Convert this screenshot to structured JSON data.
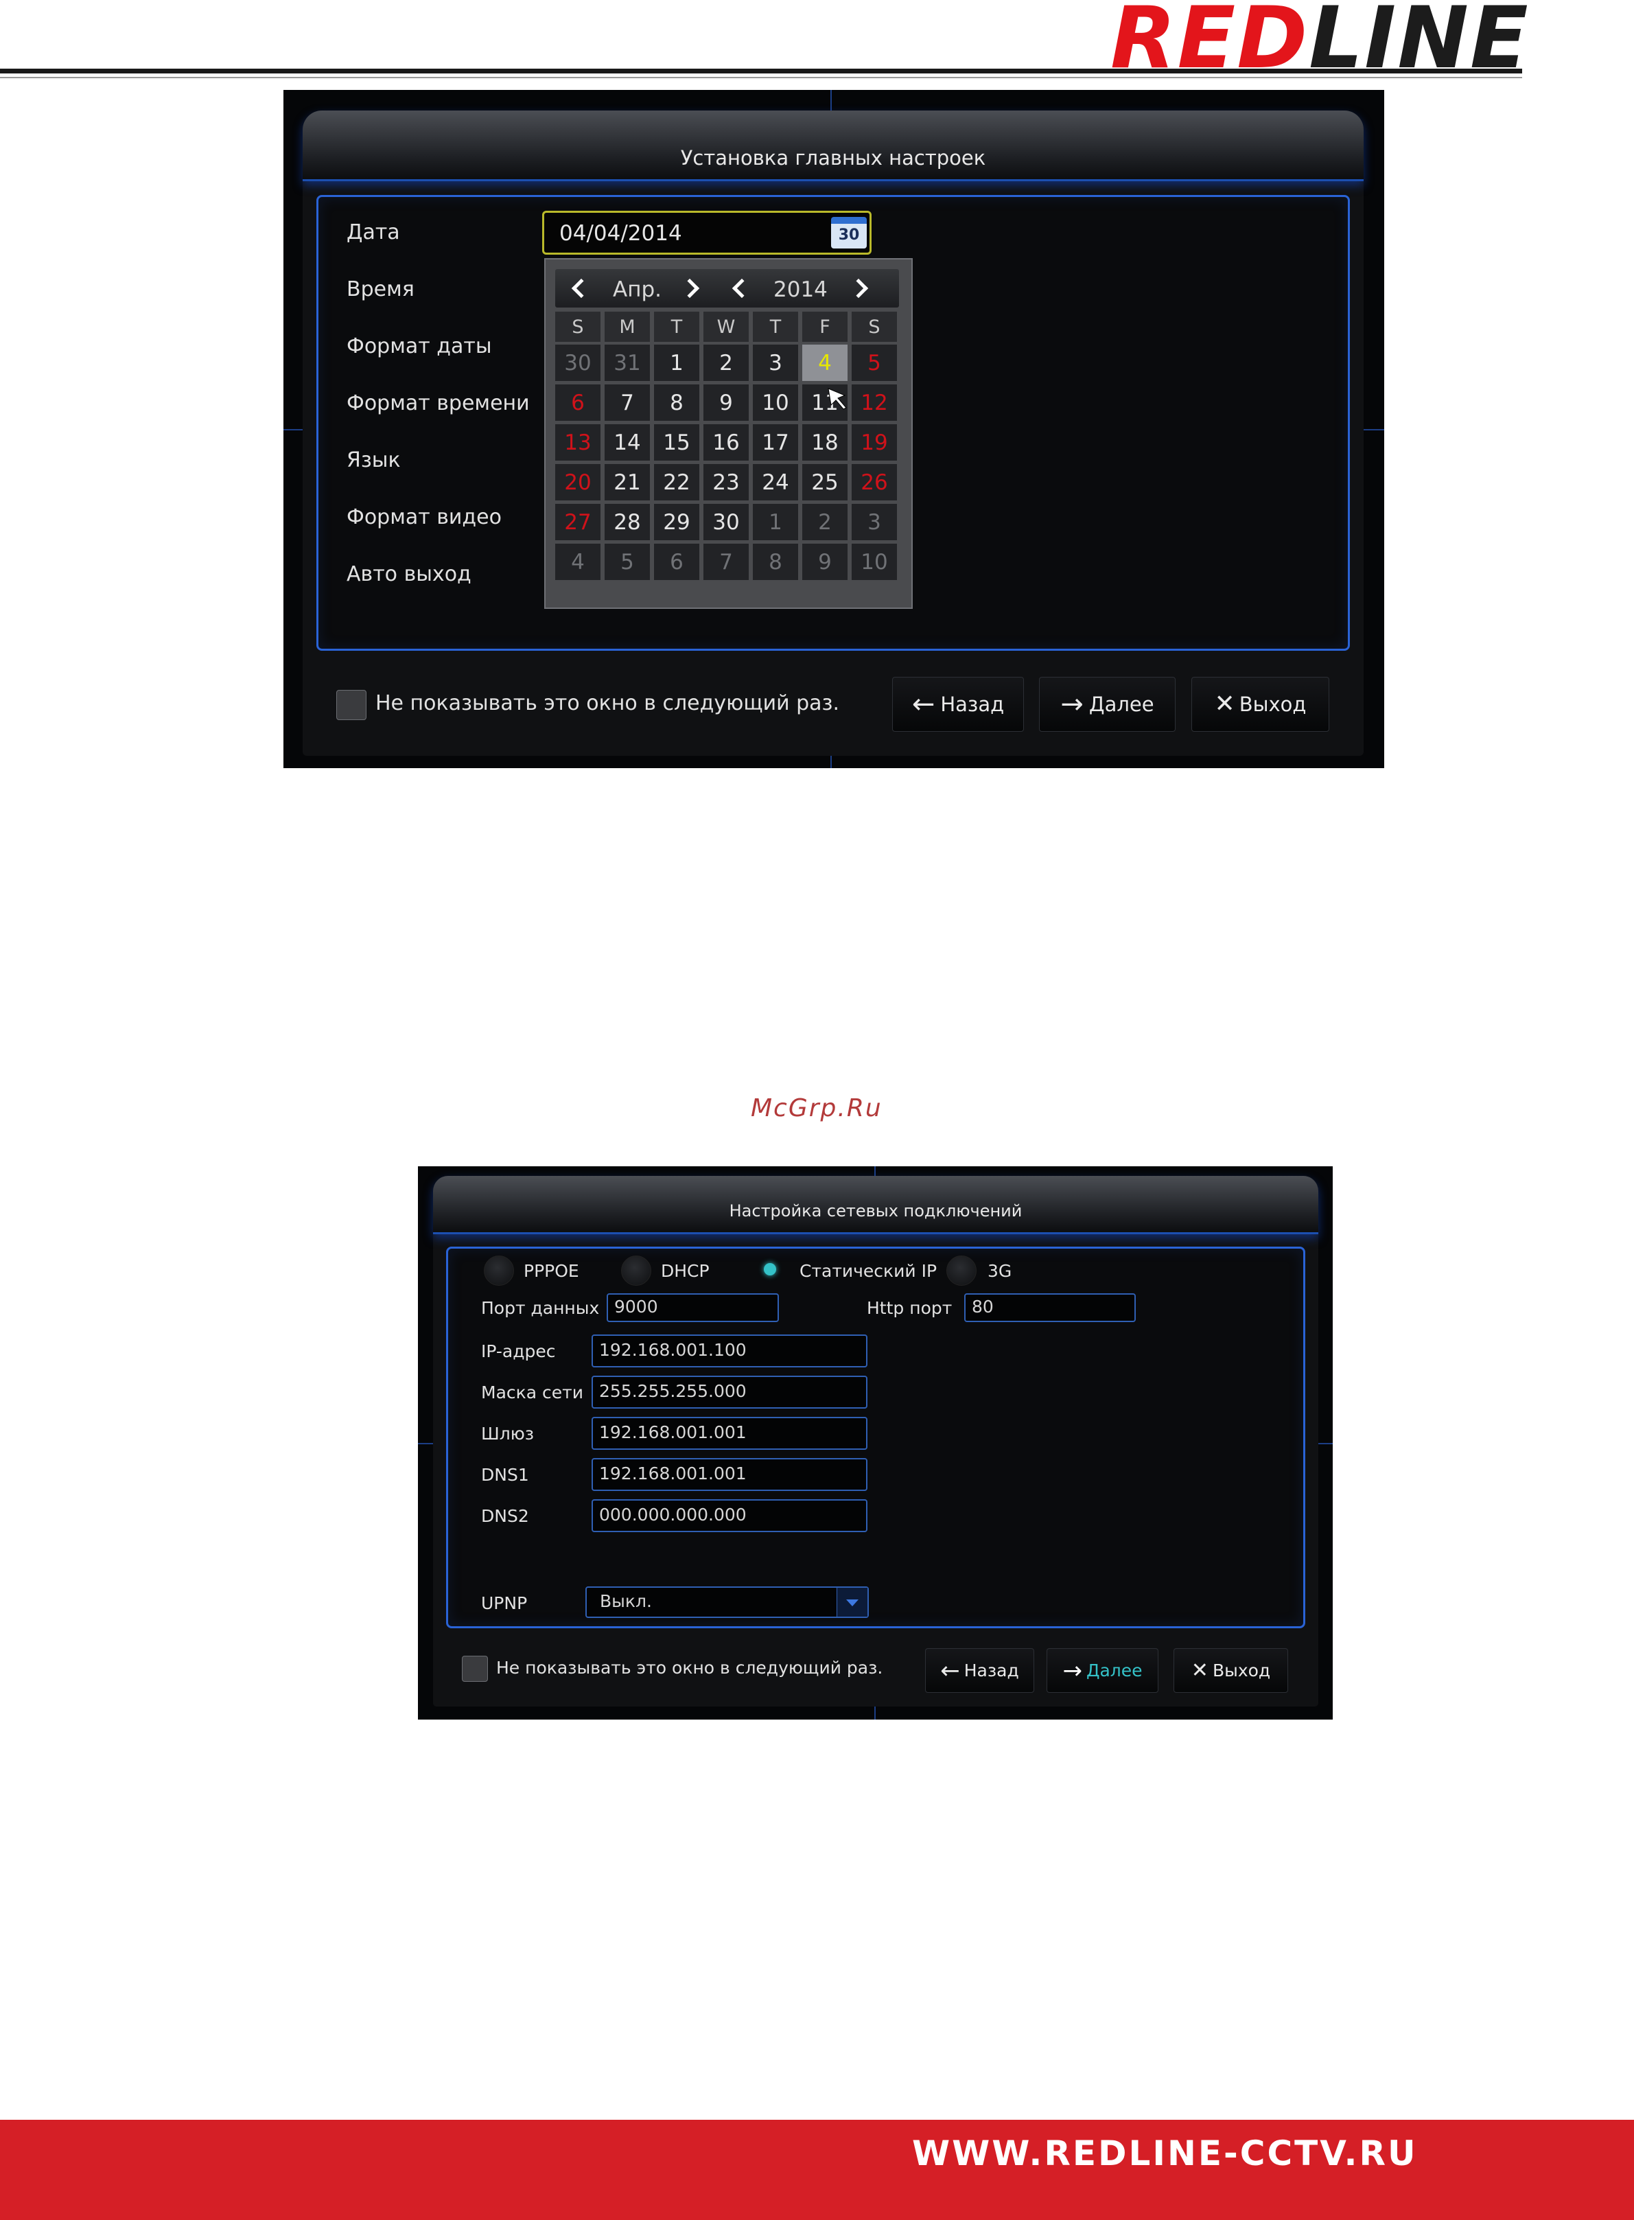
{
  "header": {
    "logo_red": "RED",
    "logo_dark": "LINE"
  },
  "general_setup": {
    "title": "Установка главных настроек",
    "labels": [
      "Дата",
      "Время",
      "Формат даты",
      "Формат времени",
      "Язык",
      "Формат видео",
      "Авто выход"
    ],
    "date_value": "04/04/2014",
    "calendar_icon_text": "30",
    "calendar": {
      "month": "Апр.",
      "year": "2014",
      "weekdays": [
        "S",
        "M",
        "T",
        "W",
        "T",
        "F",
        "S"
      ],
      "rows": [
        [
          "30",
          "31",
          "1",
          "2",
          "3",
          "4",
          "5"
        ],
        [
          "6",
          "7",
          "8",
          "9",
          "10",
          "11",
          "12"
        ],
        [
          "13",
          "14",
          "15",
          "16",
          "17",
          "18",
          "19"
        ],
        [
          "20",
          "21",
          "22",
          "23",
          "24",
          "25",
          "26"
        ],
        [
          "27",
          "28",
          "29",
          "30",
          "1",
          "2",
          "3"
        ],
        [
          "4",
          "5",
          "6",
          "7",
          "8",
          "9",
          "10"
        ]
      ],
      "selected": "4"
    },
    "checkbox_label": "Не показывать это окно в следующий раз.",
    "buttons": {
      "back": "Назад",
      "next": "Далее",
      "exit": "Выход"
    }
  },
  "watermark": "McGrp.Ru",
  "network_setup": {
    "title": "Настройка сетевых подключений",
    "modes": [
      "PPPOE",
      "DHCP",
      "Статический IP",
      "3G"
    ],
    "selected_mode": "Статический IP",
    "data_port_label": "Порт данных",
    "data_port": "9000",
    "http_port_label": "Http порт",
    "http_port": "80",
    "fields": [
      {
        "label": "IP-адрес",
        "value": "192.168.001.100"
      },
      {
        "label": "Маска сети",
        "value": "255.255.255.000"
      },
      {
        "label": "Шлюз",
        "value": "192.168.001.001"
      },
      {
        "label": "DNS1",
        "value": "192.168.001.001"
      },
      {
        "label": "DNS2",
        "value": "000.000.000.000"
      }
    ],
    "upnp_label": "UPNP",
    "upnp_value": "Выкл.",
    "checkbox_label": "Не показывать это окно в следующий раз.",
    "buttons": {
      "back": "Назад",
      "next": "Далее",
      "exit": "Выход"
    }
  },
  "footer": {
    "url": "WWW.REDLINE-CCTV.RU"
  },
  "colors": {
    "brand_red": "#e3151b",
    "footer_red": "#d51f26",
    "dvr_blue": "#2a63d6",
    "weekend_red": "#d0121a",
    "selected_day": "#e6e600",
    "active_next": "#34c2c8"
  }
}
